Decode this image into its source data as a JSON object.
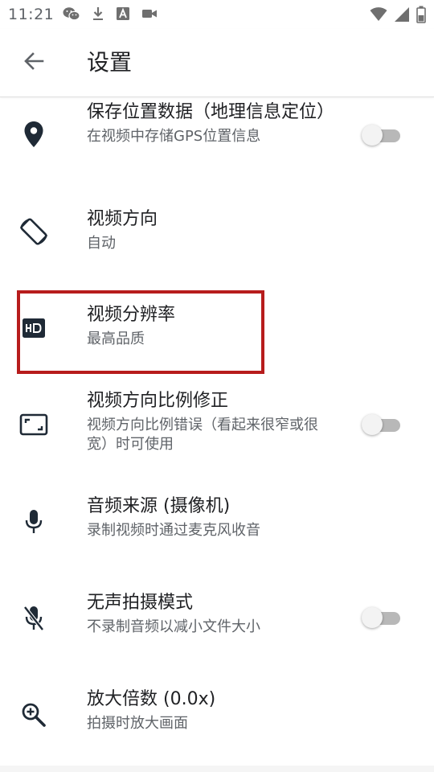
{
  "status_bar": {
    "time": "11:21",
    "left_icons": [
      "wechat-icon",
      "download-icon",
      "font-icon",
      "video-camera-icon"
    ],
    "right_icons": [
      "wifi-icon",
      "signal-icon",
      "battery-icon"
    ]
  },
  "app_bar": {
    "title": "设置",
    "back_icon": "arrow-back-icon"
  },
  "settings": [
    {
      "icon": "location-pin-icon",
      "title": "保存位置数据（地理信息定位）",
      "subtitle": "在视频中存储GPS位置信息",
      "toggle": false
    },
    {
      "icon": "screen-rotation-icon",
      "title": "视频方向",
      "subtitle": "自动"
    },
    {
      "icon": "hd-icon",
      "title": "视频分辨率",
      "subtitle": "最高品质",
      "highlighted": true
    },
    {
      "icon": "aspect-ratio-icon",
      "title": "视频方向比例修正",
      "subtitle": "视频方向比例错误（看起来很窄或很宽）时可使用",
      "toggle": false
    },
    {
      "icon": "microphone-icon",
      "title": "音频来源 (摄像机)",
      "subtitle": "录制视频时通过麦克风收音"
    },
    {
      "icon": "microphone-off-icon",
      "title": "无声拍摄模式",
      "subtitle": "不录制音频以减小文件大小",
      "toggle": false
    },
    {
      "icon": "zoom-in-icon",
      "title": "放大倍数 (0.0x)",
      "subtitle": "拍摄时放大画面"
    }
  ],
  "colors": {
    "highlight_border": "#b71c1c",
    "icon": "#1f2a36",
    "toggle_track": "#b8b8b8",
    "toggle_thumb": "#f3f3f3"
  }
}
